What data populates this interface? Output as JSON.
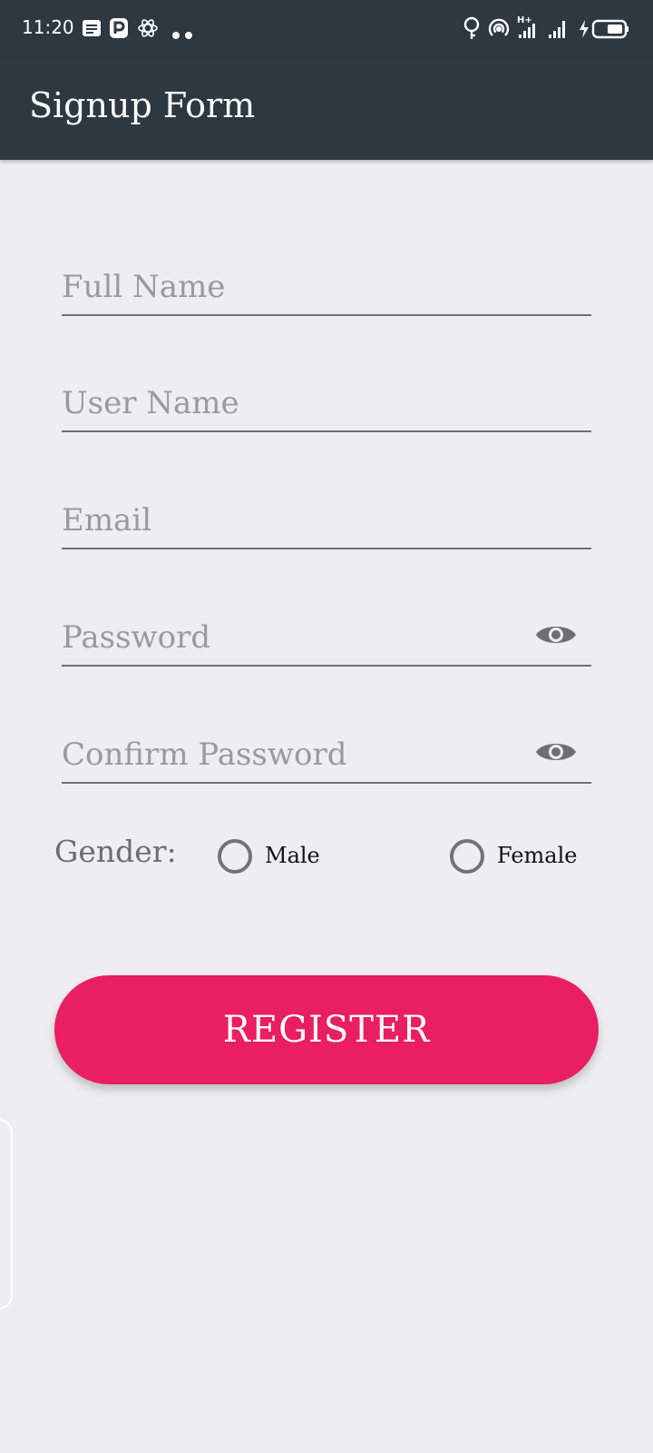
{
  "status_bar": {
    "time": "11:20",
    "icons": [
      "notes-icon",
      "p-app-icon",
      "atom-icon",
      "more-dots-icon",
      "location-icon",
      "hotspot-icon",
      "signal-hplus-icon",
      "signal-icon",
      "battery-charging-icon"
    ],
    "signal_label": "H+"
  },
  "app_bar": {
    "title": "Signup Form"
  },
  "form": {
    "full_name": {
      "placeholder": "Full Name"
    },
    "user_name": {
      "placeholder": "User Name"
    },
    "email": {
      "placeholder": "Email"
    },
    "password": {
      "placeholder": "Password",
      "icon": "eye-icon"
    },
    "confirm_password": {
      "placeholder": "Confirm Password",
      "icon": "eye-icon"
    },
    "gender": {
      "label": "Gender:",
      "options": [
        {
          "label": "Male",
          "selected": false
        },
        {
          "label": "Female",
          "selected": false
        }
      ]
    },
    "register_label": "REGISTER"
  },
  "colors": {
    "app_bar": "#2e3841",
    "background": "#eeeef0",
    "accent": "#e91e63",
    "placeholder": "#9a9a9e",
    "underline": "#6f6f73"
  }
}
